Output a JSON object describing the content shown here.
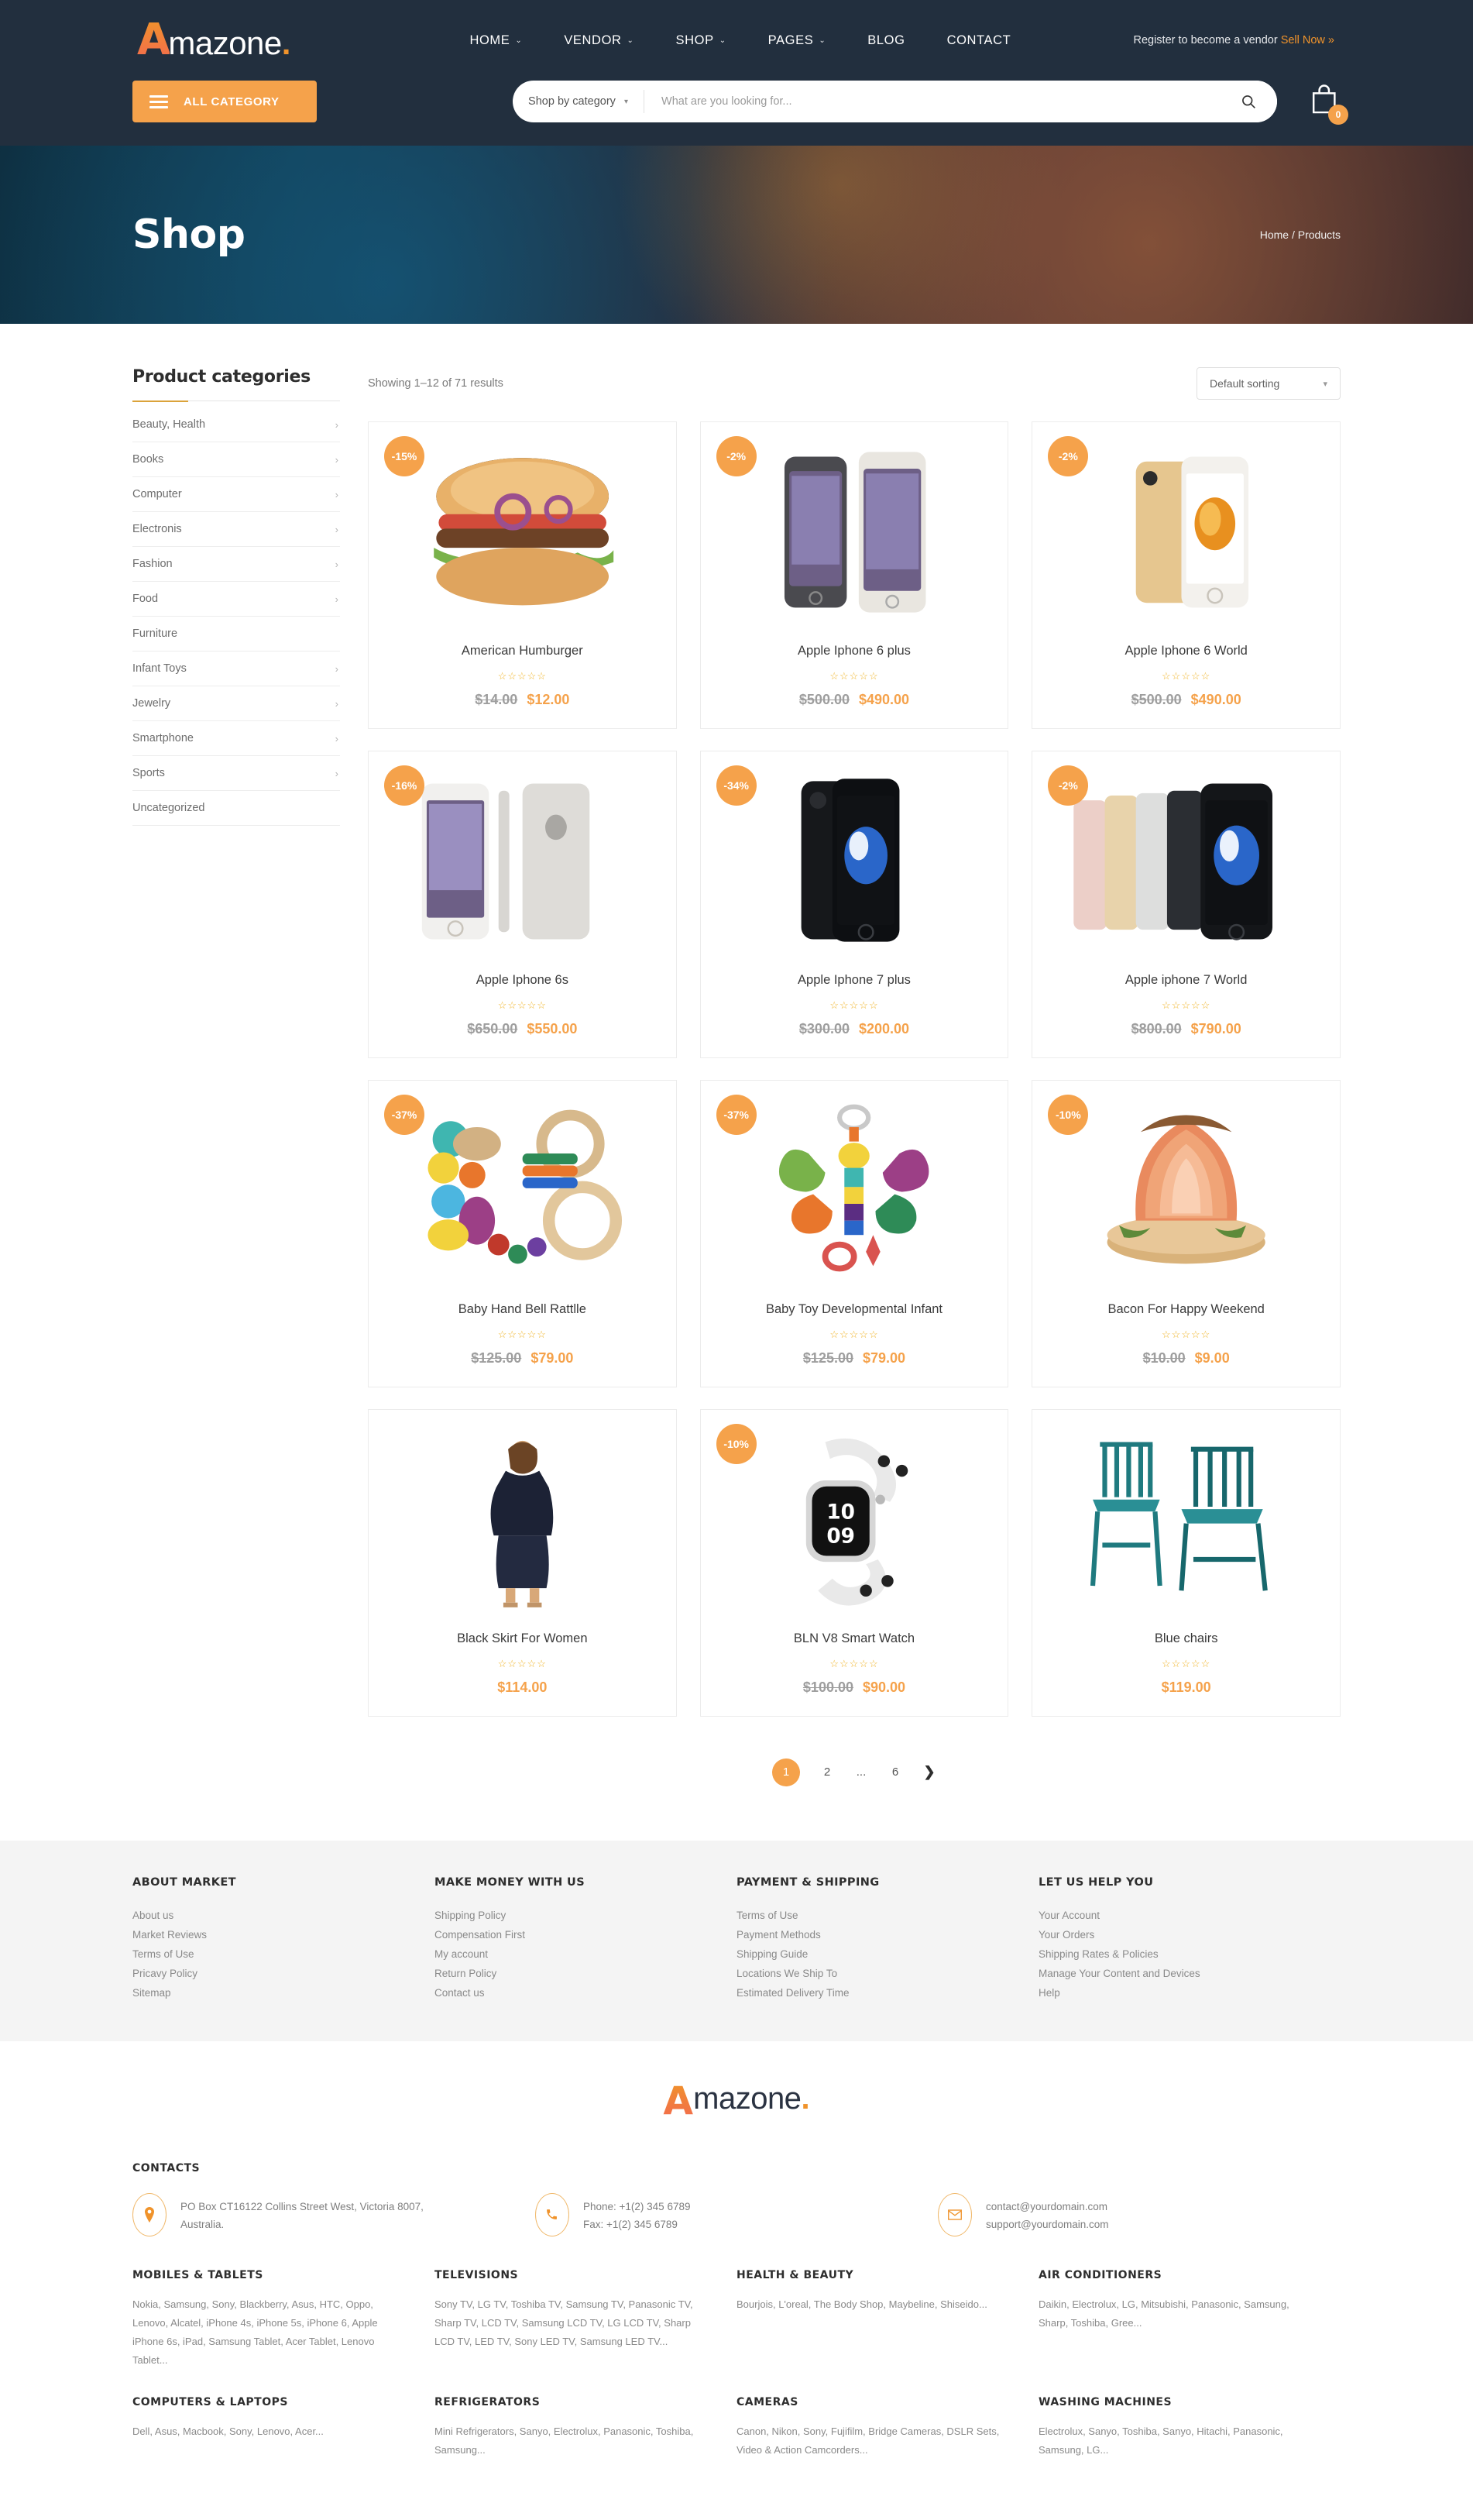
{
  "header": {
    "logo": {
      "initial": "A",
      "rest": "mazone",
      "dot": "."
    },
    "nav": [
      {
        "label": "HOME",
        "caret": "⌄"
      },
      {
        "label": "VENDOR",
        "caret": "⌄"
      },
      {
        "label": "SHOP",
        "caret": "⌄"
      },
      {
        "label": "PAGES",
        "caret": "⌄"
      },
      {
        "label": "BLOG",
        "caret": ""
      },
      {
        "label": "CONTACT",
        "caret": ""
      }
    ],
    "vendor_text": "Register to become a vendor",
    "sell_now": "Sell Now »",
    "all_category": "ALL CATEGORY",
    "search_category": "Shop by category",
    "search_placeholder": "What are you looking for...",
    "cart_count": "0"
  },
  "banner": {
    "title": "Shop",
    "breadcrumb": "Home / Products"
  },
  "sidebar": {
    "title": "Product categories",
    "items": [
      {
        "label": "Beauty, Health",
        "chev": "›"
      },
      {
        "label": "Books",
        "chev": "›"
      },
      {
        "label": "Computer",
        "chev": "›"
      },
      {
        "label": "Electronis",
        "chev": "›"
      },
      {
        "label": "Fashion",
        "chev": "›"
      },
      {
        "label": "Food",
        "chev": "›"
      },
      {
        "label": "Furniture",
        "chev": ""
      },
      {
        "label": "Infant Toys",
        "chev": "›"
      },
      {
        "label": "Jewelry",
        "chev": "›"
      },
      {
        "label": "Smartphone",
        "chev": "›"
      },
      {
        "label": "Sports",
        "chev": "›"
      },
      {
        "label": "Uncategorized",
        "chev": ""
      }
    ]
  },
  "toolbar": {
    "showing": "Showing 1–12 of 71 results",
    "sorting": "Default sorting",
    "sorting_caret": "⌄"
  },
  "products": [
    {
      "name": "American Humburger",
      "badge": "-15%",
      "old": "$14.00",
      "new": "$12.00",
      "stars": "☆☆☆☆☆",
      "art": "burger"
    },
    {
      "name": "Apple Iphone 6 plus",
      "badge": "-2%",
      "old": "$500.00",
      "new": "$490.00",
      "stars": "☆☆☆☆☆",
      "art": "two-phones"
    },
    {
      "name": "Apple Iphone 6 World",
      "badge": "-2%",
      "old": "$500.00",
      "new": "$490.00",
      "stars": "☆☆☆☆☆",
      "art": "gold-phone"
    },
    {
      "name": "Apple Iphone 6s",
      "badge": "-16%",
      "old": "$650.00",
      "new": "$550.00",
      "stars": "☆☆☆☆☆",
      "art": "silver-phones"
    },
    {
      "name": "Apple Iphone 7 plus",
      "badge": "-34%",
      "old": "$300.00",
      "new": "$200.00",
      "stars": "☆☆☆☆☆",
      "art": "black-phone"
    },
    {
      "name": "Apple iphone 7 World",
      "badge": "-2%",
      "old": "$800.00",
      "new": "$790.00",
      "stars": "☆☆☆☆☆",
      "art": "phone-lineup"
    },
    {
      "name": "Baby Hand Bell Rattlle",
      "badge": "-37%",
      "old": "$125.00",
      "new": "$79.00",
      "stars": "☆☆☆☆☆",
      "art": "rattle"
    },
    {
      "name": "Baby Toy Developmental Infant",
      "badge": "-37%",
      "old": "$125.00",
      "new": "$79.00",
      "stars": "☆☆☆☆☆",
      "art": "baby-toy"
    },
    {
      "name": "Bacon For Happy Weekend",
      "badge": "-10%",
      "old": "$10.00",
      "new": "$9.00",
      "stars": "☆☆☆☆☆",
      "art": "bacon"
    },
    {
      "name": "Black Skirt For Women",
      "badge": "",
      "old": "",
      "new": "$114.00",
      "stars": "☆☆☆☆☆",
      "art": "dress"
    },
    {
      "name": "BLN V8 Smart Watch",
      "badge": "-10%",
      "old": "$100.00",
      "new": "$90.00",
      "stars": "☆☆☆☆☆",
      "art": "watch"
    },
    {
      "name": "Blue chairs",
      "badge": "",
      "old": "",
      "new": "$119.00",
      "stars": "☆☆☆☆☆",
      "art": "chairs"
    }
  ],
  "pagination": {
    "pages": [
      "1",
      "2",
      "...",
      "6"
    ],
    "next": "❯",
    "active": "1"
  },
  "footer_links": [
    {
      "title": "ABOUT MARKET",
      "links": [
        "About us",
        "Market Reviews",
        "Terms of Use",
        "Pricavy Policy",
        "Sitemap"
      ]
    },
    {
      "title": "MAKE MONEY WITH US",
      "links": [
        "Shipping Policy",
        "Compensation First",
        "My account",
        "Return Policy",
        "Contact us"
      ]
    },
    {
      "title": "PAYMENT & SHIPPING",
      "links": [
        "Terms of Use",
        "Payment Methods",
        "Shipping Guide",
        "Locations We Ship To",
        "Estimated Delivery Time"
      ]
    },
    {
      "title": "LET US HELP YOU",
      "links": [
        "Your Account",
        "Your Orders",
        "Shipping Rates & Policies",
        "Manage Your Content and Devices",
        "Help"
      ]
    }
  ],
  "footer_logo": {
    "initial": "A",
    "rest": "mazone",
    "dot": "."
  },
  "contacts": {
    "title": "CONTACTS",
    "address_line1": "PO Box CT16122 Collins Street West, Victoria 8007,",
    "address_line2": "Australia.",
    "phone_line1": "Phone: +1(2) 345 6789",
    "phone_line2": "Fax: +1(2) 345 6789",
    "email_line1": "contact@yourdomain.com",
    "email_line2": "support@yourdomain.com"
  },
  "bottom_categories": [
    {
      "title": "MOBILES & TABLETS",
      "text": "Nokia, Samsung, Sony, Blackberry, Asus, HTC, Oppo, Lenovo, Alcatel, iPhone 4s, iPhone 5s, iPhone 6, Apple iPhone 6s, iPad, Samsung Tablet, Acer Tablet, Lenovo Tablet..."
    },
    {
      "title": "TELEVISIONS",
      "text": "Sony TV, LG TV, Toshiba TV, Samsung TV, Panasonic TV, Sharp TV, LCD TV, Samsung LCD TV, LG LCD TV, Sharp LCD TV, LED TV, Sony LED TV, Samsung LED TV..."
    },
    {
      "title": "HEALTH & BEAUTY",
      "text": "Bourjois, L'oreal, The Body Shop, Maybeline, Shiseido..."
    },
    {
      "title": "AIR CONDITIONERS",
      "text": "Daikin, Electrolux, LG, Mitsubishi, Panasonic, Samsung, Sharp, Toshiba, Gree..."
    },
    {
      "title": "COMPUTERS & LAPTOPS",
      "text": "Dell, Asus, Macbook, Sony, Lenovo, Acer..."
    },
    {
      "title": "REFRIGERATORS",
      "text": "Mini Refrigerators, Sanyo, Electrolux, Panasonic, Toshiba, Samsung..."
    },
    {
      "title": "CAMERAS",
      "text": "Canon, Nikon, Sony, Fujifilm, Bridge Cameras, DSLR Sets, Video & Action Camcorders..."
    },
    {
      "title": "WASHING MACHINES",
      "text": "Electrolux, Sanyo, Toshiba, Sanyo, Hitachi, Panasonic, Samsung, LG..."
    }
  ],
  "colors": {
    "accent": "#f5a24b",
    "dark": "#222f3e",
    "price": "#f5a24b",
    "star": "#f0b429"
  }
}
